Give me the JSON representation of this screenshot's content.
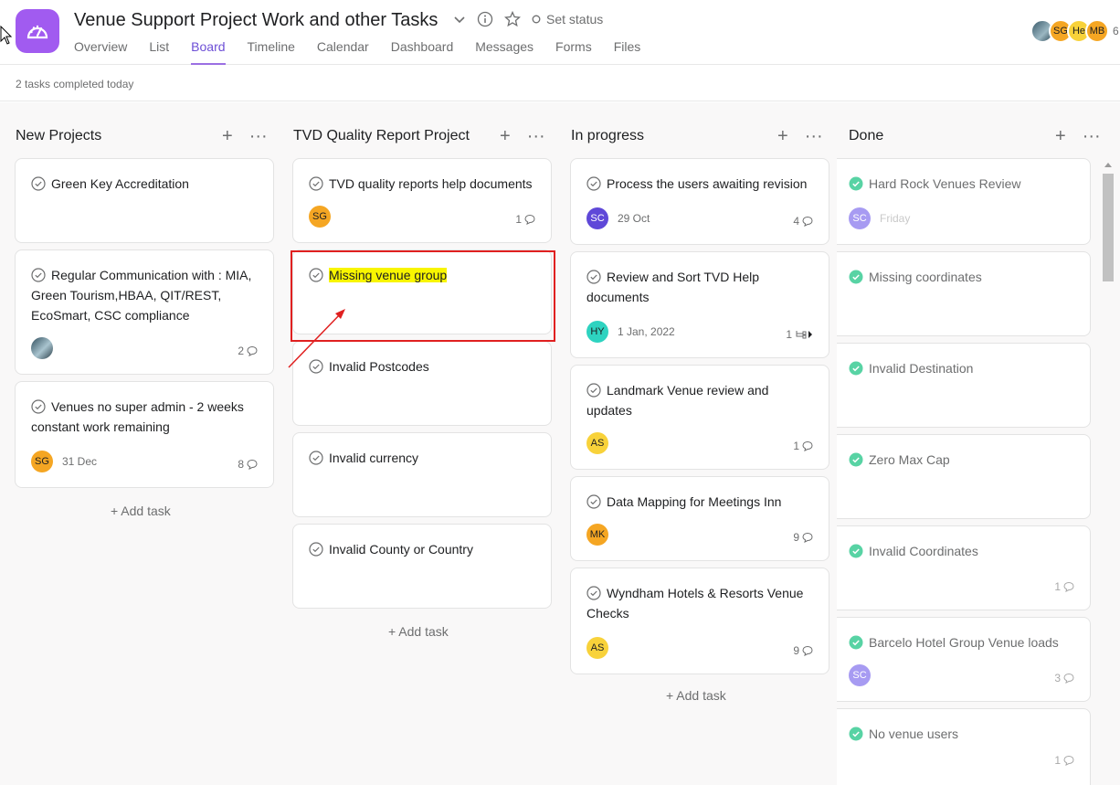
{
  "project": {
    "title": "Venue Support Project Work and other Tasks",
    "set_status": "Set status",
    "tabs": [
      "Overview",
      "List",
      "Board",
      "Timeline",
      "Calendar",
      "Dashboard",
      "Messages",
      "Forms",
      "Files"
    ],
    "active_tab": "Board",
    "members": [
      "SG",
      "He",
      "MB"
    ],
    "member_count": "6"
  },
  "subbar": {
    "completed_text": "2 tasks completed today"
  },
  "add_task_label": "+ Add task",
  "colors": {
    "accent": "#a15bf0",
    "done_check": "#58d3a4",
    "highlight": "#f8f500",
    "annotation": "#e02020"
  },
  "columns": [
    {
      "title": "New Projects",
      "cards": [
        {
          "name": "Green Key Accreditation"
        },
        {
          "name": "Regular Communication with : MIA, Green Tourism,HBAA, QIT/REST, EcoSmart, CSC compliance",
          "assignee": "photo",
          "comments": "2"
        },
        {
          "name": "Venues no super admin - 2 weeks constant work remaining",
          "assignee": "SG",
          "due": "31 Dec",
          "comments": "8"
        }
      ]
    },
    {
      "title": "TVD Quality Report Project",
      "cards": [
        {
          "name": "TVD quality reports help documents",
          "assignee": "SG",
          "comments": "1"
        },
        {
          "name": "Missing venue group",
          "highlighted": true
        },
        {
          "name": "Invalid Postcodes"
        },
        {
          "name": "Invalid currency"
        },
        {
          "name": "Invalid County or Country"
        }
      ]
    },
    {
      "title": "In progress",
      "cards": [
        {
          "name": "Process the users awaiting revision",
          "assignee": "SC",
          "due": "29 Oct",
          "comments": "4"
        },
        {
          "name": "Review and Sort TVD Help documents",
          "assignee": "HY",
          "due": "1 Jan, 2022",
          "subtasks": "1"
        },
        {
          "name": "Landmark Venue review and updates",
          "assignee": "AS",
          "comments": "1"
        },
        {
          "name": "Data Mapping for Meetings Inn",
          "assignee": "MK",
          "comments": "9"
        },
        {
          "name": "Wyndham Hotels & Resorts Venue Checks",
          "assignee": "AS",
          "comments": "9"
        }
      ]
    },
    {
      "title": "Done",
      "cards": [
        {
          "name": "Hard Rock Venues Review",
          "assignee": "SC",
          "due": "Friday"
        },
        {
          "name": "Missing coordinates"
        },
        {
          "name": "Invalid Destination"
        },
        {
          "name": "Zero Max Cap"
        },
        {
          "name": "Invalid Coordinates",
          "comments": "1"
        },
        {
          "name": "Barcelo Hotel Group Venue loads",
          "assignee": "SC",
          "comments": "3"
        },
        {
          "name": "No venue users",
          "comments": "1"
        }
      ]
    }
  ]
}
